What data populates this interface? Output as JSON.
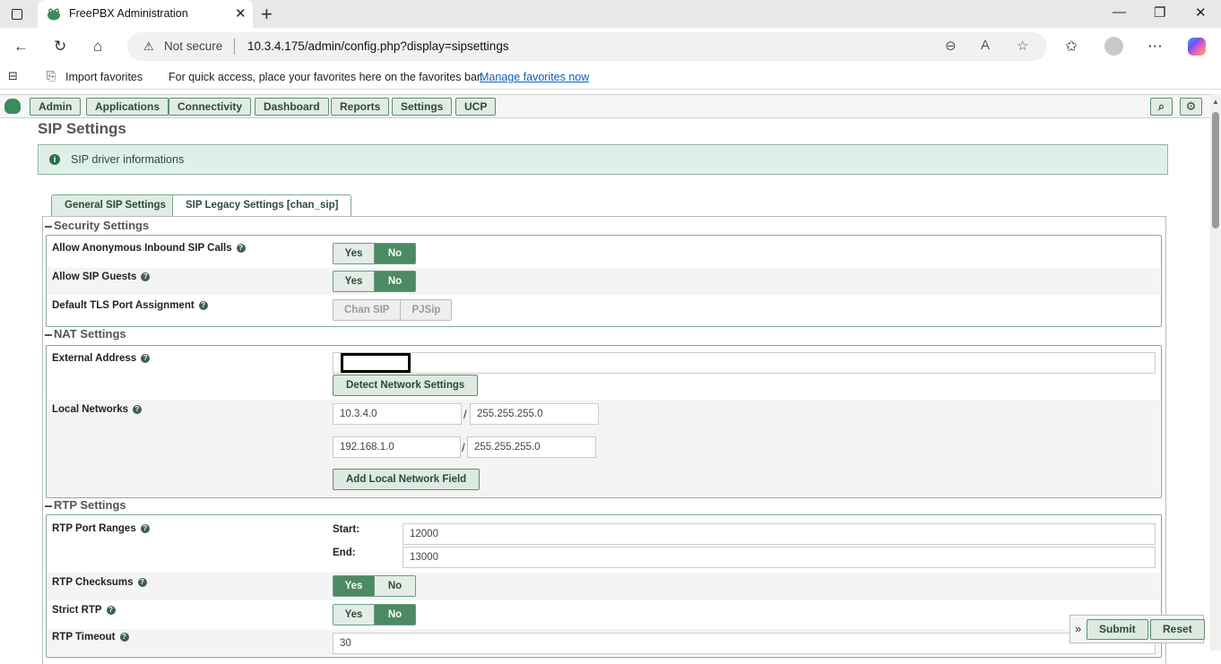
{
  "browser": {
    "tab_title": "FreePBX Administration",
    "address_warning": "Not secure",
    "url": "10.3.4.175/admin/config.php?display=sipsettings"
  },
  "favbar": {
    "import": "Import favorites",
    "message": "For quick access, place your favorites here on the favorites bar.",
    "manage_link": "Manage favorites now"
  },
  "menu": [
    "Admin",
    "Applications",
    "Connectivity",
    "Dashboard",
    "Reports",
    "Settings",
    "UCP"
  ],
  "page": {
    "title": "SIP Settings",
    "info": "SIP driver informations",
    "tabs": [
      "General SIP Settings",
      "SIP Legacy Settings [chan_sip]"
    ]
  },
  "security": {
    "legend": "Security Settings",
    "anon_label": "Allow Anonymous Inbound SIP Calls",
    "guests_label": "Allow SIP Guests",
    "tls_label": "Default TLS Port Assignment",
    "yes": "Yes",
    "no": "No",
    "chan_sip": "Chan SIP",
    "pjsip": "PJSip"
  },
  "nat": {
    "legend": "NAT Settings",
    "external_label": "External Address",
    "detect_button": "Detect Network Settings",
    "local_label": "Local Networks",
    "net1_ip": "10.3.4.0",
    "net1_mask": "255.255.255.0",
    "net2_ip": "192.168.1.0",
    "net2_mask": "255.255.255.0",
    "add_button": "Add Local Network Field"
  },
  "rtp": {
    "legend": "RTP Settings",
    "ports_label": "RTP Port Ranges",
    "start_label": "Start:",
    "start_value": "12000",
    "end_label": "End:",
    "end_value": "13000",
    "checksums_label": "RTP Checksums",
    "strict_label": "Strict RTP",
    "timeout_label": "RTP Timeout",
    "timeout_value": "30"
  },
  "footer": {
    "submit": "Submit",
    "reset": "Reset"
  }
}
